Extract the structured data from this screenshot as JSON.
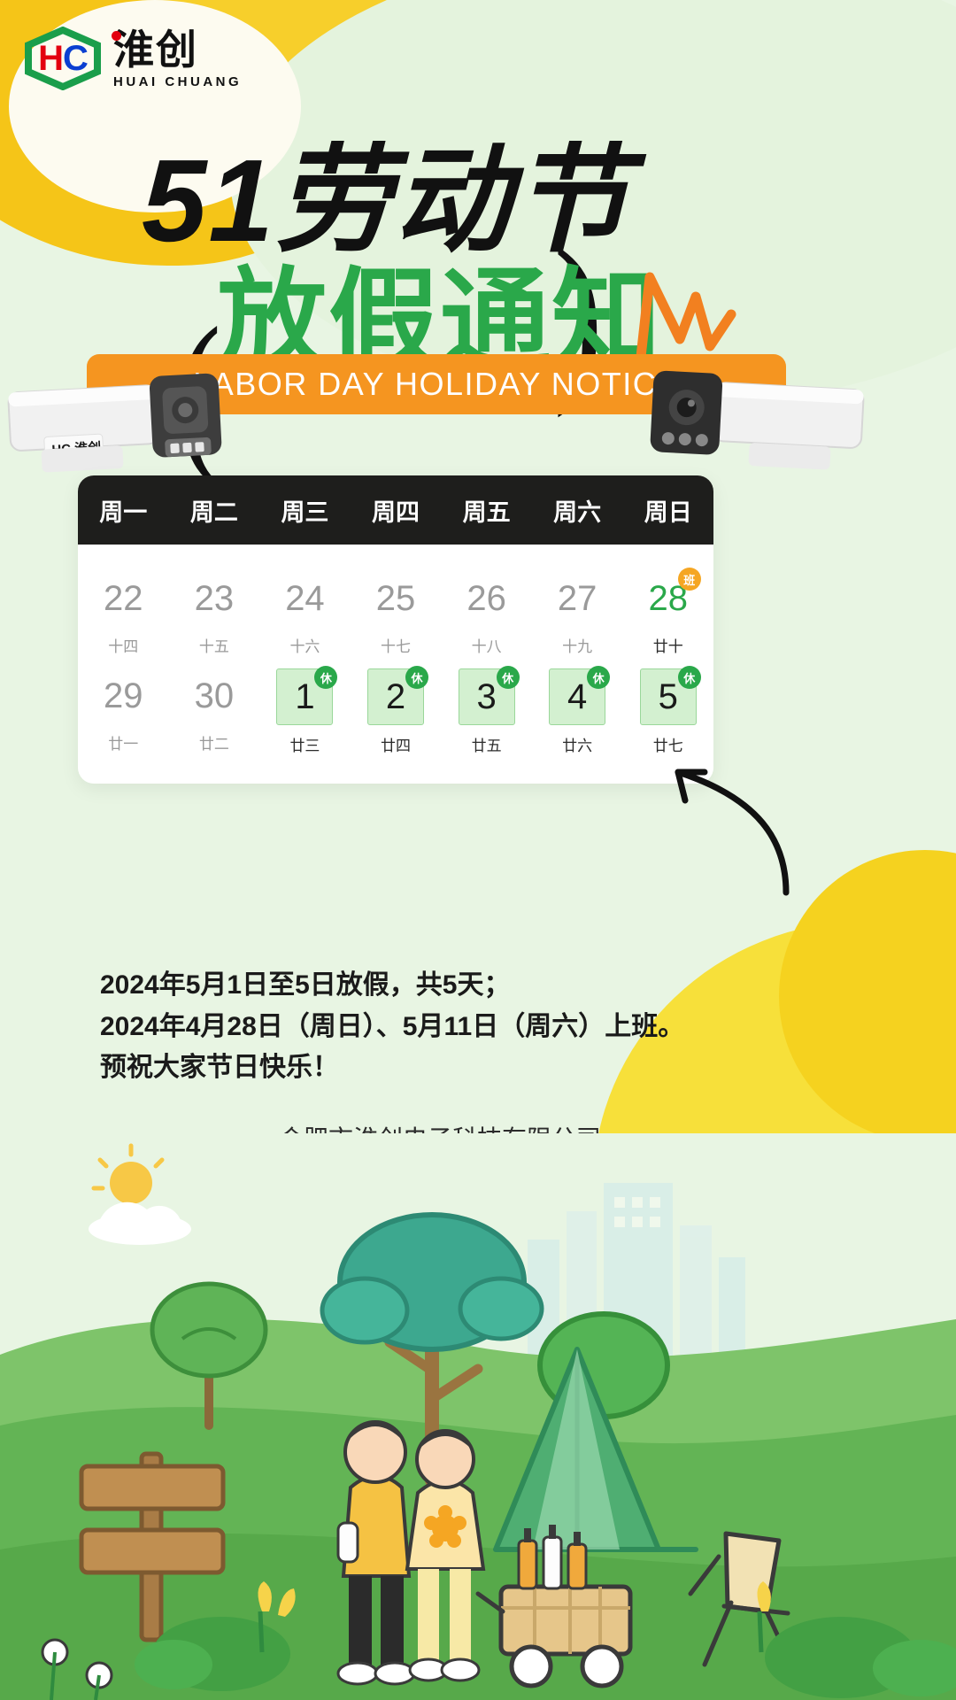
{
  "brand": {
    "mark_text": "HC",
    "mark_h": "H",
    "mark_c": "C",
    "name_cn": "淮创",
    "name_en": "HUAI CHUANG",
    "color_hex_green": "#1a9e4b",
    "color_hex_red": "#e3000f",
    "color_hex_blue": "#0b3fd1"
  },
  "headline": {
    "line1": "51劳动节",
    "line2": "放假通知",
    "line1_color": "#111111",
    "line2_color": "#2aa84a"
  },
  "banner": {
    "text": "LABOR DAY HOLIDAY NOTICE",
    "background_hex": "#f59520",
    "text_color_hex": "#ffffff"
  },
  "calendar": {
    "weekdays": [
      "周一",
      "周二",
      "周三",
      "周四",
      "周五",
      "周六",
      "周日"
    ],
    "rows": [
      [
        {
          "day": "22",
          "lunar": "十四",
          "type": "normal",
          "badge": ""
        },
        {
          "day": "23",
          "lunar": "十五",
          "type": "normal",
          "badge": ""
        },
        {
          "day": "24",
          "lunar": "十六",
          "type": "normal",
          "badge": ""
        },
        {
          "day": "25",
          "lunar": "十七",
          "type": "normal",
          "badge": ""
        },
        {
          "day": "26",
          "lunar": "十八",
          "type": "normal",
          "badge": ""
        },
        {
          "day": "27",
          "lunar": "十九",
          "type": "normal",
          "badge": ""
        },
        {
          "day": "28",
          "lunar": "廿十",
          "type": "work",
          "badge": "班"
        }
      ],
      [
        {
          "day": "29",
          "lunar": "廿一",
          "type": "normal",
          "badge": ""
        },
        {
          "day": "30",
          "lunar": "廿二",
          "type": "normal",
          "badge": ""
        },
        {
          "day": "1",
          "lunar": "廿三",
          "type": "rest",
          "badge": "休"
        },
        {
          "day": "2",
          "lunar": "廿四",
          "type": "rest",
          "badge": "休"
        },
        {
          "day": "3",
          "lunar": "廿五",
          "type": "rest",
          "badge": "休"
        },
        {
          "day": "4",
          "lunar": "廿六",
          "type": "rest",
          "badge": "休"
        },
        {
          "day": "5",
          "lunar": "廿七",
          "type": "rest",
          "badge": "休"
        }
      ]
    ],
    "highlight_bg_hex": "#d3f0d0",
    "rest_badge_hex": "#2aa84a",
    "work_badge_hex": "#f5a623"
  },
  "notice": {
    "line1": "2024年5月1日至5日放假，共5天；",
    "line2": "2024年4月28日（周日）、5月11日（周六）上班。",
    "line3": "预祝大家节日快乐！"
  },
  "company": {
    "name": "合肥市淮创电子科技有限公司"
  }
}
